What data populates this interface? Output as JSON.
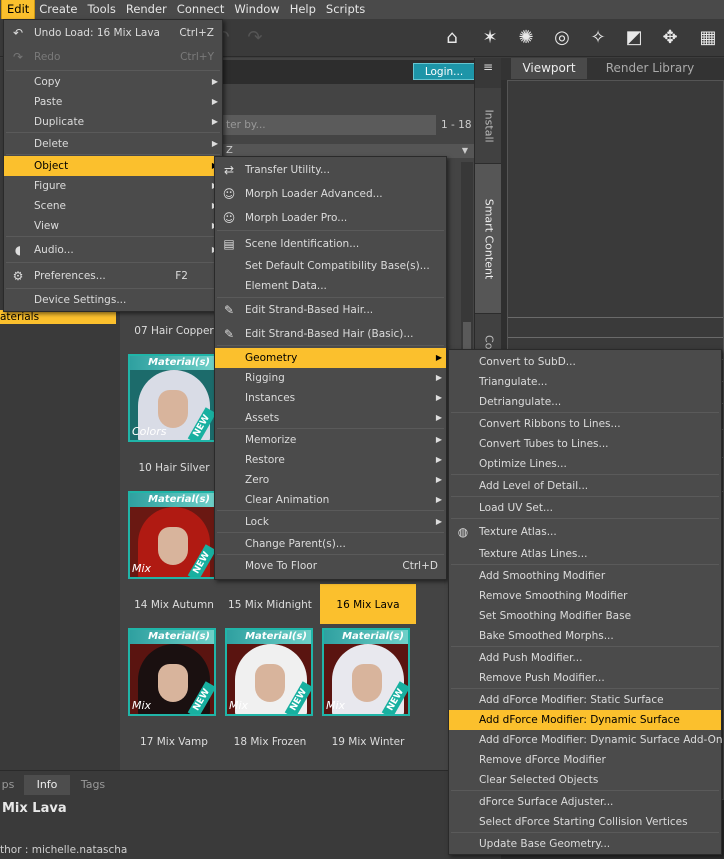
{
  "menubar": {
    "items": [
      "Edit",
      "Create",
      "Tools",
      "Render",
      "Connect",
      "Window",
      "Help",
      "Scripts"
    ]
  },
  "toolbar": {
    "icons": [
      "undo-icon",
      "redo-icon",
      "camera-icon",
      "light-icon",
      "spotlight-icon",
      "target-icon",
      "sparkle-icon",
      "eraser-icon",
      "orbit-icon",
      "grid-icon"
    ]
  },
  "library": {
    "login": "Login...",
    "filter_placeholder": "ter by...",
    "range": "1 - 18",
    "sort": "Z",
    "materials_label": "aterials"
  },
  "side_tabs": [
    "Install",
    "Smart Content",
    "Content Libr"
  ],
  "viewport": {
    "tab_viewport": "Viewport",
    "tab_render": "Render Library"
  },
  "products": [
    {
      "name": "07 Hair Copper"
    },
    {
      "name": "10 Hair Silver",
      "badge": "Material(s)",
      "tag": "Colors"
    },
    {
      "name": "14 Mix Autumn",
      "badge": "Material(s)",
      "tag": "Mix"
    },
    {
      "name": "15 Mix Midnight"
    },
    {
      "name": "16 Mix Lava"
    },
    {
      "name": "17 Mix Vamp",
      "badge": "Material(s)",
      "tag": "Mix"
    },
    {
      "name": "18 Mix Frozen",
      "badge": "Material(s)",
      "tag": "Mix"
    },
    {
      "name": "19 Mix Winter",
      "badge": "Material(s)",
      "tag": "Mix"
    }
  ],
  "new_badge": "NEW",
  "bottom": {
    "tabs": [
      "ps",
      "Info",
      "Tags"
    ],
    "product_name": "Mix Lava",
    "author": "thor : michelle.natascha"
  },
  "edit_menu": [
    {
      "label": "Undo Load: 16 Mix Lava",
      "key": "Ctrl+Z",
      "icon": "undo-icon"
    },
    {
      "label": "Redo",
      "key": "Ctrl+Y",
      "disabled": true,
      "icon": "redo-icon"
    },
    {
      "label": "Copy"
    },
    {
      "label": "Paste"
    },
    {
      "label": "Duplicate"
    },
    {
      "label": "Delete"
    },
    {
      "label": "Object"
    },
    {
      "label": "Figure"
    },
    {
      "label": "Scene"
    },
    {
      "label": "View"
    },
    {
      "label": "Audio...",
      "icon": "speaker-icon"
    },
    {
      "label": "Preferences...",
      "key": "F2",
      "icon": "gear-icon"
    },
    {
      "label": "Device Settings..."
    }
  ],
  "object_menu": [
    {
      "label": "Transfer Utility...",
      "icon": "transfer-icon"
    },
    {
      "label": "Morph Loader Advanced...",
      "icon": "morph-icon"
    },
    {
      "label": "Morph Loader Pro...",
      "icon": "morph-icon"
    },
    {
      "label": "Scene Identification...",
      "icon": "id-card-icon"
    },
    {
      "label": "Set Default Compatibility Base(s)..."
    },
    {
      "label": "Element Data..."
    },
    {
      "label": "Edit Strand-Based Hair...",
      "icon": "brush-icon"
    },
    {
      "label": "Edit Strand-Based Hair (Basic)...",
      "icon": "brush-icon"
    },
    {
      "label": "Geometry"
    },
    {
      "label": "Rigging"
    },
    {
      "label": "Instances"
    },
    {
      "label": "Assets"
    },
    {
      "label": "Memorize"
    },
    {
      "label": "Restore"
    },
    {
      "label": "Zero"
    },
    {
      "label": "Clear Animation"
    },
    {
      "label": "Lock"
    },
    {
      "label": "Change Parent(s)..."
    },
    {
      "label": "Move To Floor",
      "key": "Ctrl+D"
    }
  ],
  "geometry_menu": [
    {
      "label": "Convert to SubD..."
    },
    {
      "label": "Triangulate..."
    },
    {
      "label": "Detriangulate..."
    },
    {
      "label": "Convert Ribbons to Lines..."
    },
    {
      "label": "Convert Tubes to Lines..."
    },
    {
      "label": "Optimize Lines..."
    },
    {
      "label": "Add Level of Detail..."
    },
    {
      "label": "Load UV Set..."
    },
    {
      "label": "Texture Atlas...",
      "icon": "globe-icon"
    },
    {
      "label": "Texture Atlas Lines..."
    },
    {
      "label": "Add Smoothing Modifier"
    },
    {
      "label": "Remove Smoothing Modifier"
    },
    {
      "label": "Set Smoothing Modifier Base"
    },
    {
      "label": "Bake Smoothed Morphs..."
    },
    {
      "label": "Add Push Modifier..."
    },
    {
      "label": "Remove Push Modifier..."
    },
    {
      "label": "Add dForce Modifier: Static Surface"
    },
    {
      "label": "Add dForce Modifier: Dynamic Surface"
    },
    {
      "label": "Add dForce Modifier: Dynamic Surface Add-On"
    },
    {
      "label": "Remove dForce Modifier"
    },
    {
      "label": "Clear Selected Objects"
    },
    {
      "label": "dForce Surface Adjuster..."
    },
    {
      "label": "Select dForce Starting Collision Vertices"
    },
    {
      "label": "Update Base Geometry..."
    }
  ],
  "colors": {
    "accent": "#fbc02d",
    "teal": "#1d95a8"
  }
}
